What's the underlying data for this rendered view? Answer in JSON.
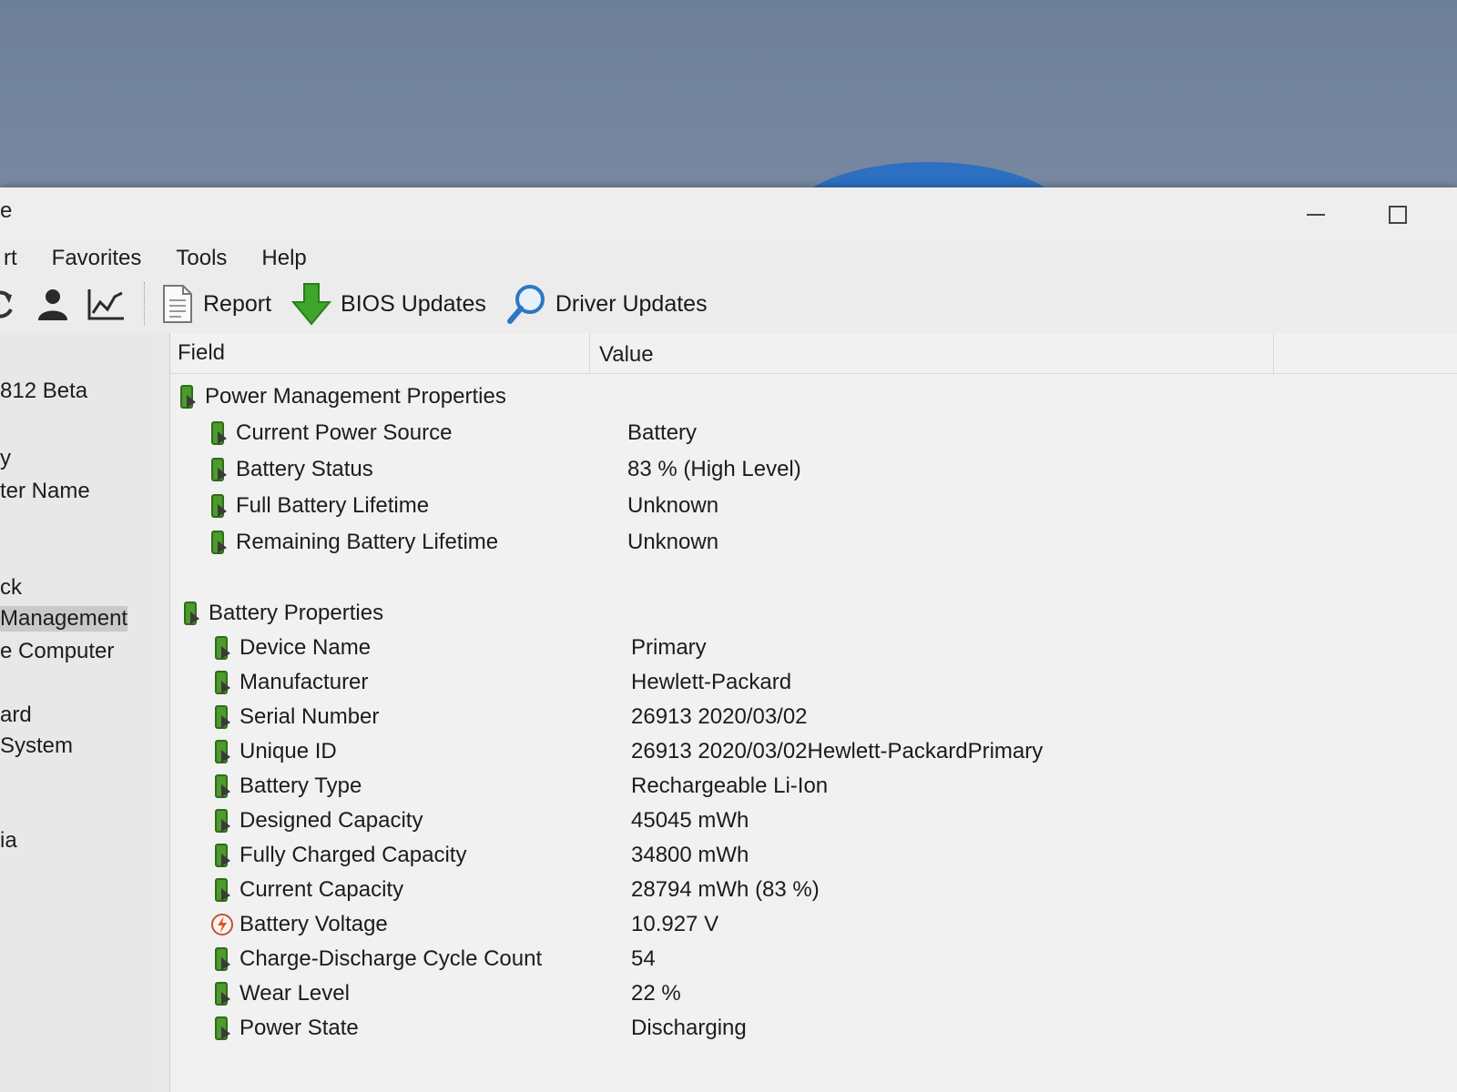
{
  "window": {
    "title_fragment": "e",
    "minimize_glyph": "—",
    "maximize_glyph": "☐"
  },
  "menu": {
    "items": [
      "rt",
      "Favorites",
      "Tools",
      "Help"
    ]
  },
  "toolbar": {
    "icons": [
      "refresh-icon",
      "user-icon",
      "benchmark-chart-icon"
    ],
    "report_label": "Report",
    "bios_label": "BIOS Updates",
    "driver_label": "Driver Updates"
  },
  "sidebar": {
    "items": [
      {
        "label": "812 Beta",
        "selected": false
      },
      {
        "label": "y",
        "selected": false
      },
      {
        "label": "ter Name",
        "selected": false
      },
      {
        "label": "ck",
        "selected": false
      },
      {
        "label": "Management",
        "selected": true
      },
      {
        "label": "e Computer",
        "selected": false
      },
      {
        "label": "ard",
        "selected": false
      },
      {
        "label": "System",
        "selected": false
      },
      {
        "label": "ia",
        "selected": false
      }
    ]
  },
  "table": {
    "header_field": "Field",
    "header_value": "Value",
    "groups": [
      {
        "title": "Power Management Properties",
        "rows": [
          {
            "field": "Current Power Source",
            "value": "Battery",
            "icon": "battery-icon"
          },
          {
            "field": "Battery Status",
            "value": "83 % (High Level)",
            "icon": "battery-icon"
          },
          {
            "field": "Full Battery Lifetime",
            "value": "Unknown",
            "icon": "battery-icon"
          },
          {
            "field": "Remaining Battery Lifetime",
            "value": "Unknown",
            "icon": "battery-icon"
          }
        ]
      },
      {
        "title": "Battery Properties",
        "rows": [
          {
            "field": "Device Name",
            "value": "Primary",
            "icon": "battery-icon"
          },
          {
            "field": "Manufacturer",
            "value": "Hewlett-Packard",
            "icon": "battery-icon"
          },
          {
            "field": "Serial Number",
            "value": "26913 2020/03/02",
            "icon": "battery-icon"
          },
          {
            "field": "Unique ID",
            "value": "26913 2020/03/02Hewlett-PackardPrimary",
            "icon": "battery-icon"
          },
          {
            "field": "Battery Type",
            "value": "Rechargeable Li-Ion",
            "icon": "battery-icon"
          },
          {
            "field": "Designed Capacity",
            "value": "45045 mWh",
            "icon": "battery-icon"
          },
          {
            "field": "Fully Charged Capacity",
            "value": "34800 mWh",
            "icon": "battery-icon"
          },
          {
            "field": "Current Capacity",
            "value": "28794 mWh  (83 %)",
            "icon": "battery-icon"
          },
          {
            "field": "Battery Voltage",
            "value": "10.927 V",
            "icon": "voltage-icon"
          },
          {
            "field": "Charge-Discharge Cycle Count",
            "value": "54",
            "icon": "battery-icon"
          },
          {
            "field": "Wear Level",
            "value": "22 %",
            "icon": "battery-icon"
          },
          {
            "field": "Power State",
            "value": "Discharging",
            "icon": "battery-icon"
          }
        ]
      }
    ]
  }
}
